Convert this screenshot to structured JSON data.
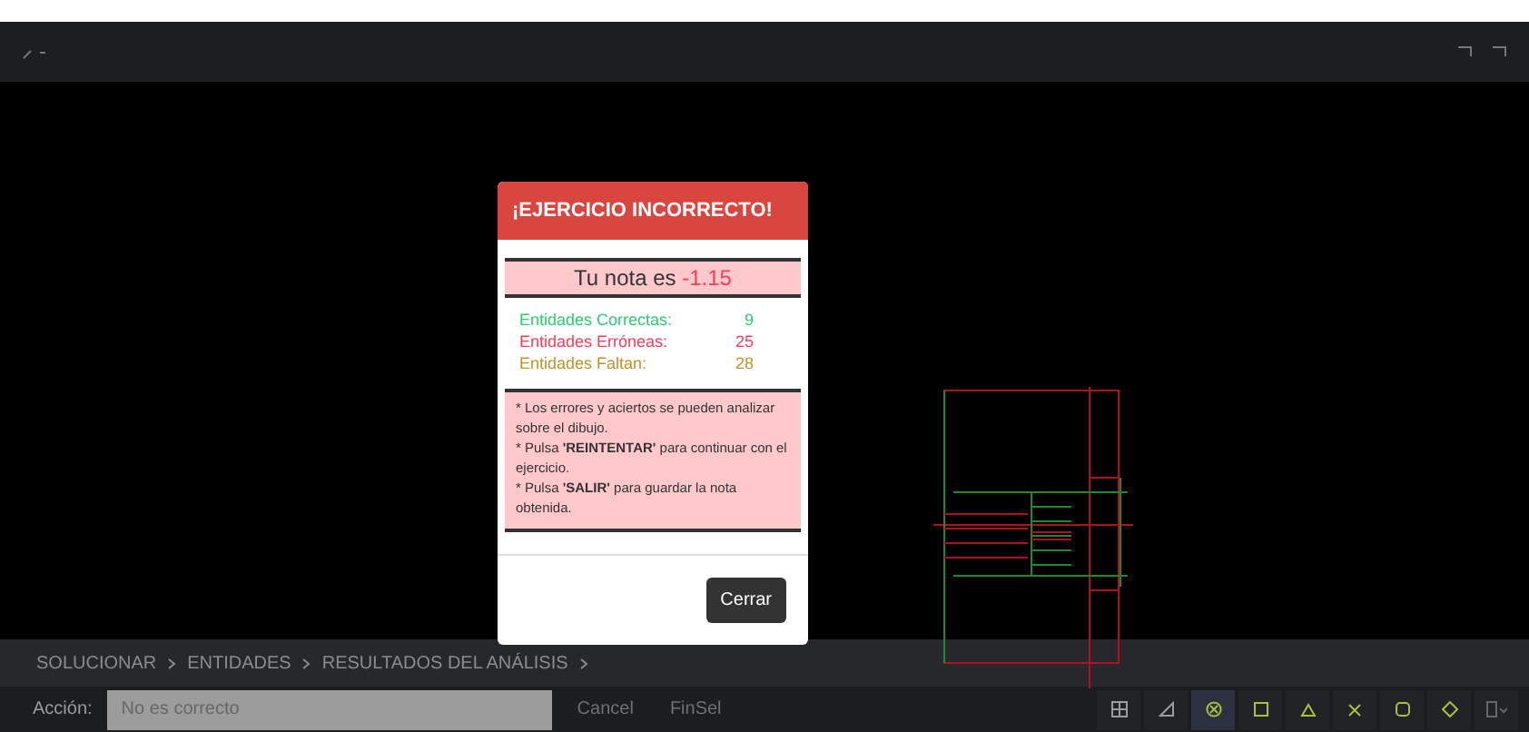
{
  "dialog": {
    "title": "¡EJERCICIO INCORRECTO!",
    "score_label": "Tu nota es",
    "score_value": "-1.15",
    "stats": [
      {
        "label": "Entidades Correctas:",
        "value": "9",
        "color": "#2ecc71"
      },
      {
        "label": "Entidades Erróneas:",
        "value": "25",
        "color": "#ff3b5c"
      },
      {
        "label": "Entidades Faltan:",
        "value": "28",
        "color": "#b8962e"
      }
    ],
    "notes": [
      "* Los errores y aciertos se pueden analizar sobre el dibujo.",
      "* Pulsa **'REINTENTAR'** para continuar con el ejercicio.",
      "* Pulsa **'SALIR'** para guardar la nota obtenida."
    ],
    "close_button": "Cerrar"
  },
  "breadcrumb": [
    "SOLUCIONAR",
    "ENTIDADES",
    "RESULTADOS DEL ANÁLISIS"
  ],
  "command_bar": {
    "label": "Acción:",
    "value": "No es correcto",
    "options": [
      "Cancel",
      "FinSel"
    ]
  },
  "tools": [
    {
      "kind": "grid",
      "selected": false
    },
    {
      "kind": "angle",
      "selected": false
    },
    {
      "kind": "circle",
      "selected": true
    },
    {
      "kind": "square",
      "selected": false
    },
    {
      "kind": "triangle",
      "selected": false
    },
    {
      "kind": "cross",
      "selected": false
    },
    {
      "kind": "rounded",
      "selected": false
    },
    {
      "kind": "diamond",
      "selected": false
    },
    {
      "kind": "device",
      "selected": false
    }
  ]
}
